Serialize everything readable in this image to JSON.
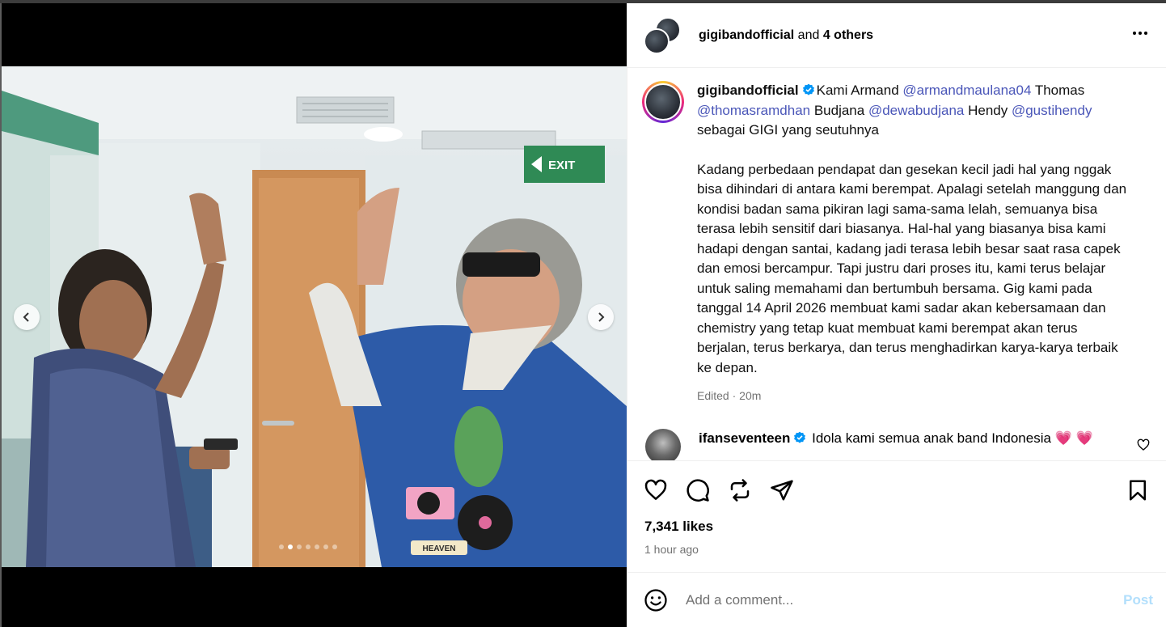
{
  "header": {
    "username": "gigibandofficial",
    "and_label": "and",
    "others_label": "4 others",
    "more_icon": "more-horizontal-icon"
  },
  "caption": {
    "username": "gigibandofficial",
    "verified_color": "#0095f6",
    "intro_1": "Kami Armand ",
    "mention_1": "@armandmaulana04",
    "intro_2": " Thomas ",
    "mention_2": "@thomasramdhan",
    "intro_3": " Budjana ",
    "mention_3": "@dewabudjana",
    "intro_4": " Hendy ",
    "mention_4": "@gustihendy",
    "intro_5": " sebagai GIGI yang seutuhnya",
    "body": "Kadang perbedaan pendapat dan gesekan kecil jadi hal yang nggak bisa dihindari di antara kami berempat. Apalagi setelah manggung dan kondisi badan sama pikiran lagi sama-sama lelah, semuanya bisa terasa lebih sensitif dari biasanya. Hal-hal yang biasanya bisa kami hadapi dengan santai, kadang jadi terasa lebih besar saat rasa capek dan emosi bercampur. Tapi justru dari proses itu, kami terus belajar untuk saling memahami dan bertumbuh bersama. Gig kami pada tanggal 14 April 2026 membuat kami sadar akan kebersamaan dan chemistry yang tetap kuat membuat kami berempat akan terus berjalan, terus berkarya, dan terus menghadirkan karya-karya terbaik ke depan.",
    "edited": "Edited",
    "sep": "·",
    "time": "20m"
  },
  "comments": [
    {
      "username": "ifanseventeen",
      "text": "Idola kami semua anak band Indonesia",
      "emoji": "💗 💗"
    }
  ],
  "actions": {
    "like_icon": "heart-icon",
    "comment_icon": "comment-icon",
    "repost_icon": "repost-icon",
    "share_icon": "share-icon",
    "save_icon": "bookmark-icon"
  },
  "likes": "7,341 likes",
  "posted": "1 hour ago",
  "add_comment": {
    "placeholder": "Add a comment...",
    "post_label": "Post"
  },
  "carousel": {
    "total": 7,
    "active_index": 1
  },
  "photo": {
    "exit_sign": "EXIT",
    "shirt_text": "HEAVEN"
  }
}
